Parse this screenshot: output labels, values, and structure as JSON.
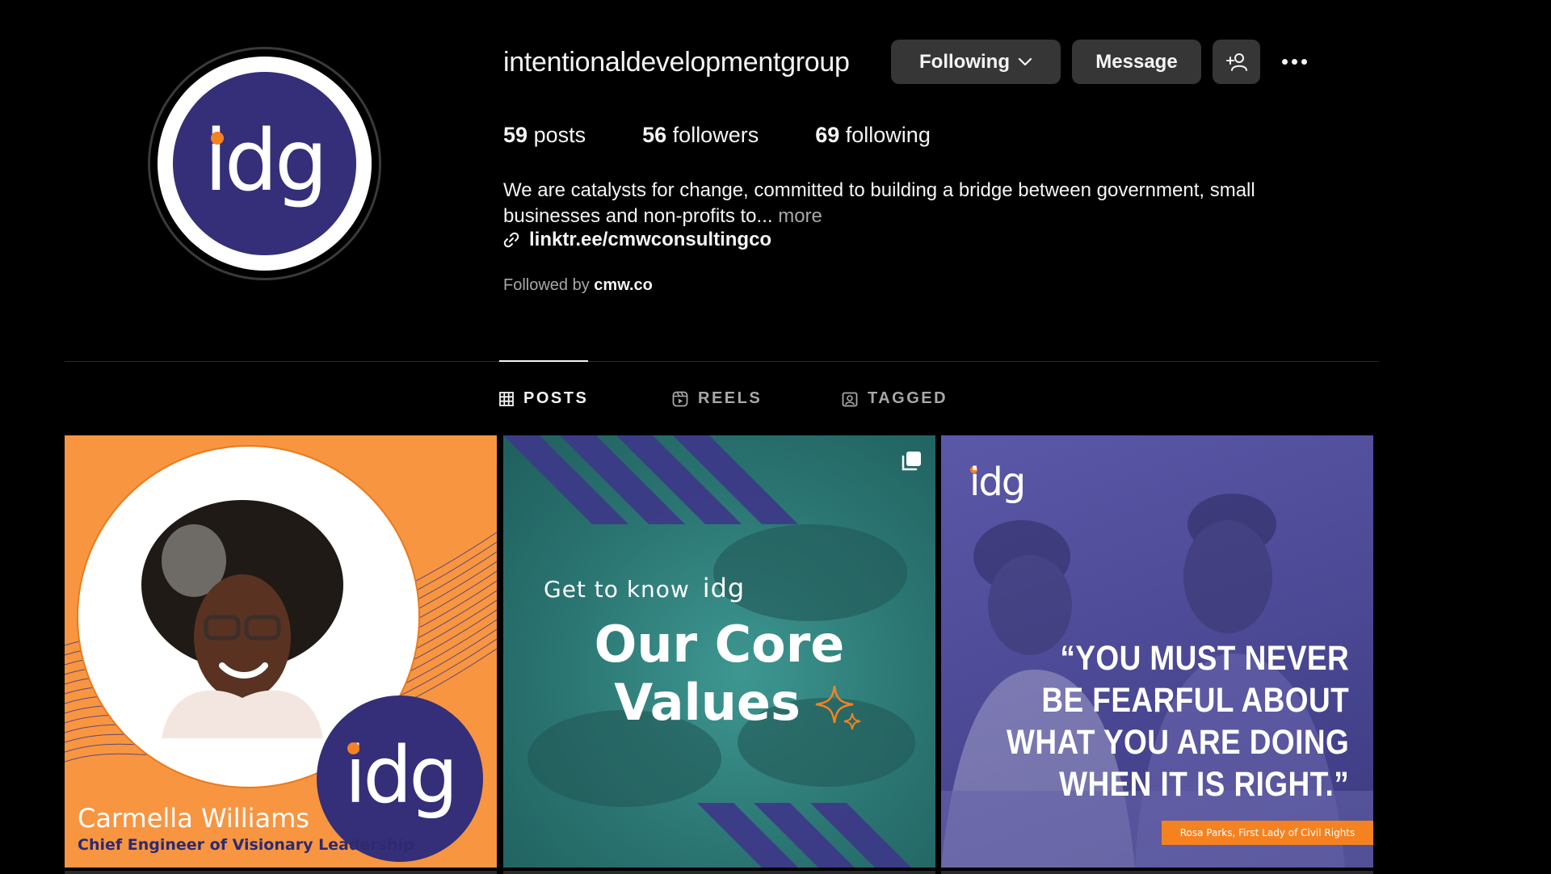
{
  "profile": {
    "username": "intentionaldevelopmentgroup",
    "avatar_text": "idg",
    "following_label": "Following",
    "message_label": "Message",
    "stats": {
      "posts_count": "59",
      "posts_label": "posts",
      "followers_count": "56",
      "followers_label": "followers",
      "following_count": "69",
      "following_label": "following"
    },
    "bio": "We are catalysts for change, committed to building a bridge between government, small businesses and non-profits to...",
    "bio_more": "more",
    "link": "linktr.ee/cmwconsultingco",
    "followed_by_prefix": "Followed by",
    "followed_by_user": "cmw.co"
  },
  "tabs": [
    {
      "label": "POSTS",
      "icon": "grid-icon",
      "active": true
    },
    {
      "label": "REELS",
      "icon": "reels-icon",
      "active": false
    },
    {
      "label": "TAGGED",
      "icon": "tagged-icon",
      "active": false
    }
  ],
  "posts": [
    {
      "logo": "idg",
      "name": "Carmella Williams",
      "title": "Chief Engineer of Visionary Leadership"
    },
    {
      "intro": "Get to know",
      "intro_logo": "idg",
      "headline_1": "Our Core",
      "headline_2": "Values",
      "multi_icon": "carousel-icon"
    },
    {
      "logo": "idg",
      "quote_1": "“YOU MUST NEVER",
      "quote_2": "BE FEARFUL ABOUT",
      "quote_3": "WHAT YOU ARE DOING",
      "quote_4": "WHEN IT IS RIGHT.”",
      "credit": "Rosa Parks, First Lady of Civil Rights"
    }
  ],
  "colors": {
    "background": "#000000",
    "button_bg": "#363636",
    "brand_purple": "#342f78",
    "brand_orange": "#f58220",
    "muted_text": "#a8a8a8"
  }
}
